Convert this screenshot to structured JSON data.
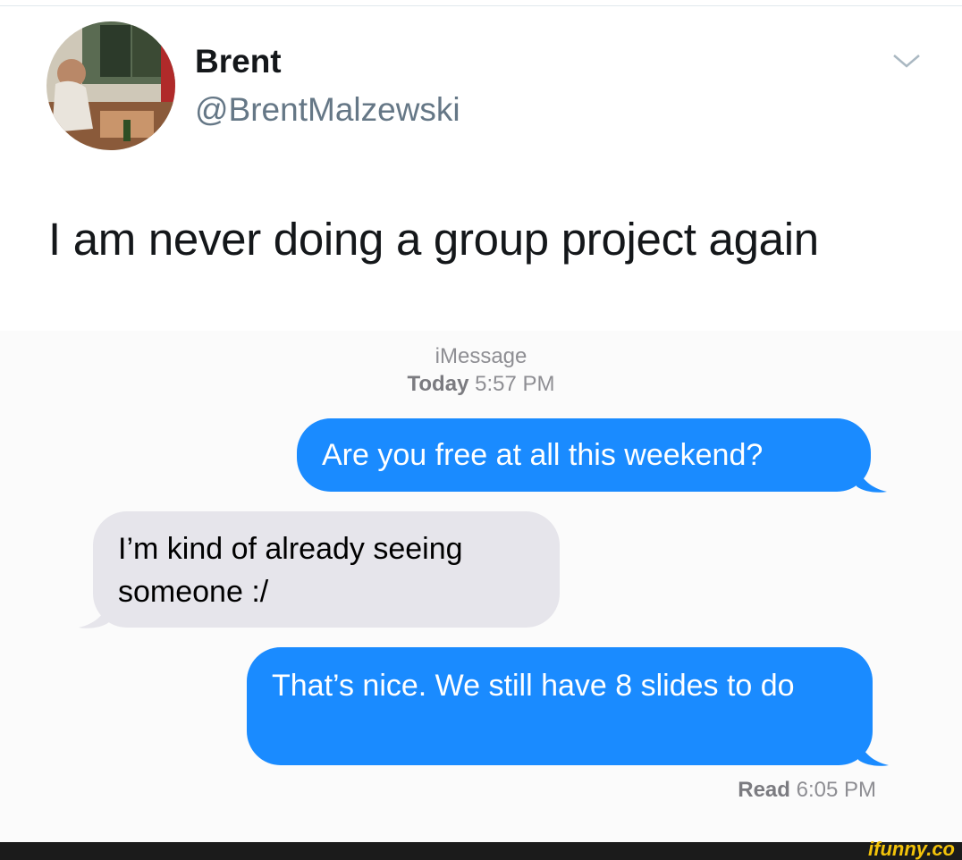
{
  "tweet": {
    "display_name": "Brent",
    "handle": "@BrentMalzewski",
    "text": "I am never doing a group project again"
  },
  "imessage": {
    "service_label": "iMessage",
    "timestamp_day": "Today",
    "timestamp_time": "5:57 PM",
    "messages": [
      {
        "direction": "outgoing",
        "text": "Are you free at all this weekend?"
      },
      {
        "direction": "incoming",
        "text": "I’m kind of already seeing someone :/"
      },
      {
        "direction": "outgoing",
        "text": "That’s nice. We still have 8 slides to do"
      }
    ],
    "read_label": "Read",
    "read_time": "6:05 PM"
  },
  "watermark": "ifunny.co",
  "colors": {
    "outgoing_bubble": "#1a8bff",
    "incoming_bubble": "#e6e5eb",
    "handle_gray": "#657786",
    "meta_gray": "#8e8e93",
    "watermark_yellow": "#f2c20a"
  },
  "icons": {
    "menu": "chevron-down-icon"
  }
}
